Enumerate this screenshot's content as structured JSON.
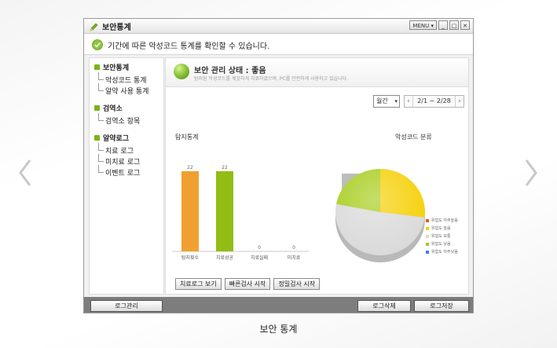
{
  "page": {
    "caption": "보안 통계"
  },
  "window": {
    "title": "보안통계",
    "menu_label": "MENU",
    "minimize": "_",
    "maximize": "□",
    "close": "✕"
  },
  "info": {
    "text": "기간에 따른 악성코드 통계를 확인할 수 있습니다."
  },
  "sidebar": {
    "groups": [
      {
        "label": "보안통계",
        "items": [
          "악성코드 통계",
          "알약 사용 통계"
        ]
      },
      {
        "label": "검역소",
        "items": [
          "검역소 항목"
        ]
      },
      {
        "label": "알약로그",
        "items": [
          "치료 로그",
          "미치료 로그",
          "이벤트 로그"
        ]
      }
    ]
  },
  "status": {
    "title": "보안 관리 상태 : 좋음",
    "subtitle": "탐지된 악성코드를 깨끗하게 치료하였으며, PC를 안전하게 사용하고 있습니다."
  },
  "filters": {
    "period": "월간",
    "range": "2/1 ~ 2/28",
    "prev": "‹",
    "next": "›"
  },
  "sections": {
    "detect_title": "탐지통계",
    "malware_title": "악성코드 분류"
  },
  "buttons": {
    "view_log": "치료로그 보기",
    "quick_scan": "빠른검사 시작",
    "full_scan": "정밀검사 시작"
  },
  "footer": {
    "log_manage": "로그관리",
    "log_delete": "로그삭제",
    "log_save": "로그저장"
  },
  "colors": {
    "bar_orange": "#f0a030",
    "bar_green": "#93bd14",
    "pie_yellow": "#f5cf00",
    "pie_green": "#a6cc1a",
    "pie_gray": "#d9d9d9",
    "accent_green": "#7ab317"
  },
  "icons": {
    "title": "pencil-icon",
    "info": "check-circle-icon",
    "zoom": "search-icon",
    "nav_prev": "chevron-left-icon",
    "nav_next": "chevron-right-icon"
  },
  "chart_data": [
    {
      "type": "bar",
      "categories": [
        "탐지횟수",
        "치료성공",
        "치료실패",
        "미치료"
      ],
      "values": [
        22,
        22,
        0,
        0
      ],
      "data_labels": [
        "22",
        "22",
        "0",
        "0"
      ],
      "title": "탐지통계",
      "ylim": [
        0,
        25
      ],
      "grid": false
    },
    {
      "type": "pie",
      "title": "악성코드 분류",
      "slices": [
        {
          "label": "위험도 아주높음",
          "value": 0,
          "color": "#e05a2b"
        },
        {
          "label": "위험도 높음",
          "value": 27,
          "color": "#f5cf00"
        },
        {
          "label": "위험도 보통",
          "value": 51,
          "color": "#d9d9d9"
        },
        {
          "label": "위험도 낮음",
          "value": 22,
          "color": "#a6cc1a"
        },
        {
          "label": "위험도 아주낮음",
          "value": 0,
          "color": "#3a7fe0"
        }
      ],
      "legend": "right"
    }
  ]
}
